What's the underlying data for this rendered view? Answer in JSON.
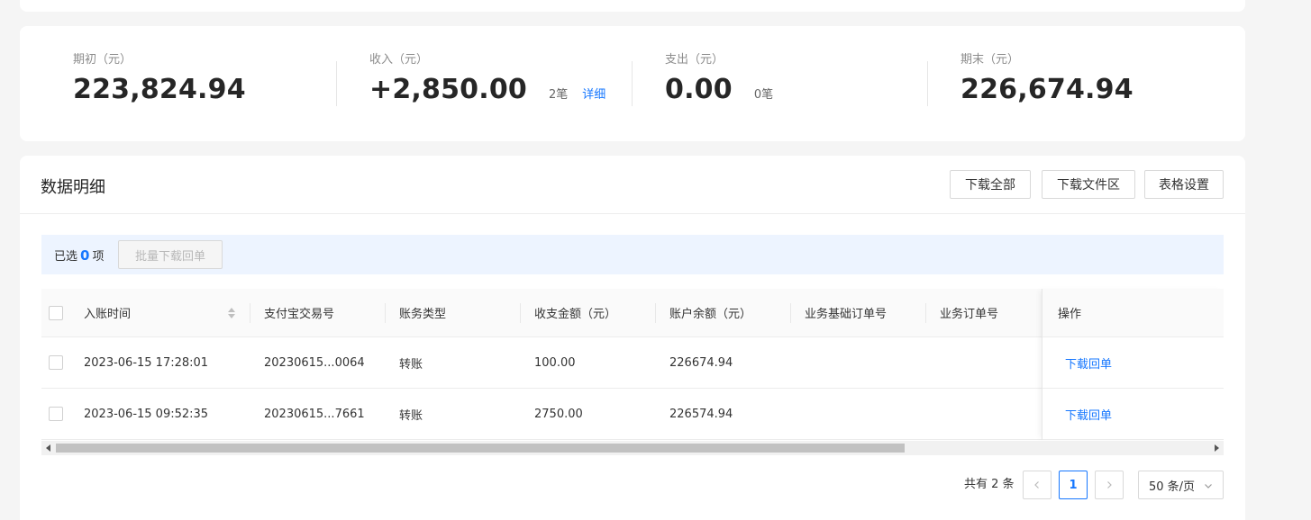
{
  "summary": {
    "opening": {
      "label": "期初（元）",
      "value": "223,824.94"
    },
    "income": {
      "label": "收入（元）",
      "value": "+2,850.00",
      "count": "2笔",
      "detail_link": "详细"
    },
    "expense": {
      "label": "支出（元）",
      "value": "0.00",
      "count": "0笔"
    },
    "closing": {
      "label": "期末（元）",
      "value": "226,674.94"
    }
  },
  "detail": {
    "title": "数据明细",
    "buttons": {
      "download_all": "下载全部",
      "download_files": "下载文件区",
      "table_settings": "表格设置"
    }
  },
  "selection": {
    "prefix": "已选",
    "count": "0",
    "suffix": "项",
    "batch_button": "批量下载回单"
  },
  "table": {
    "headers": [
      "入账时间",
      "支付宝交易号",
      "账务类型",
      "收支金额（元）",
      "账户余额（元）",
      "业务基础订单号",
      "业务订单号",
      "操作"
    ],
    "rows": [
      {
        "time": "2023-06-15 17:28:01",
        "trade_no": "20230615...0064",
        "type": "转账",
        "amount": "100.00",
        "balance": "226674.94",
        "base_order": "",
        "order": "",
        "action": "下载回单"
      },
      {
        "time": "2023-06-15 09:52:35",
        "trade_no": "20230615...7661",
        "type": "转账",
        "amount": "2750.00",
        "balance": "226574.94",
        "base_order": "",
        "order": "",
        "action": "下载回单"
      }
    ]
  },
  "pagination": {
    "total": "共有 2 条",
    "current_page": "1",
    "page_size": "50 条/页",
    "prev_icon": "chevron-left-icon",
    "next_icon": "chevron-right-icon"
  },
  "colors": {
    "accent": "#1677ff",
    "selection_bg": "#edf4ff"
  }
}
